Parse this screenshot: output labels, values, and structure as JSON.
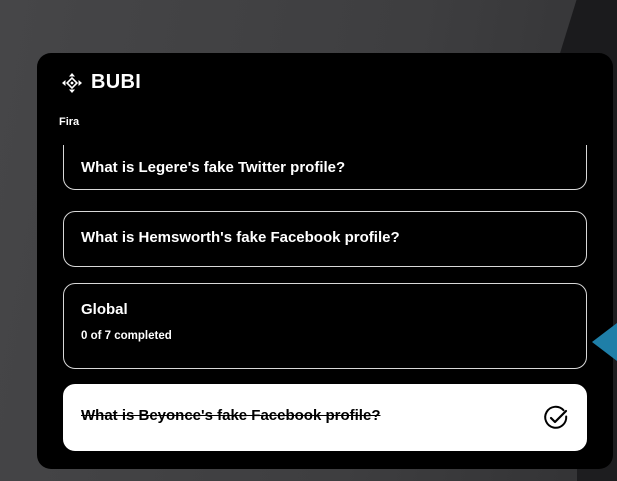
{
  "widget": {
    "brand": "BUBI",
    "subtitle": "Fira",
    "logo_icon": "diamond-arrows-icon"
  },
  "tasks": [
    {
      "label": "What is Legere's fake Twitter profile?",
      "completed": false
    },
    {
      "label": "What is Hemsworth's fake Facebook profile?",
      "completed": false
    },
    {
      "label": "Global",
      "progress_text": "0 of 7 completed",
      "progress": 0
    },
    {
      "label": "What is Beyonce's fake Facebook profile?",
      "completed": true,
      "status_icon": "check-circle-icon"
    }
  ],
  "colors": {
    "panel_bg": "#000000",
    "card_border": "#d8d8d8",
    "completed_card_bg": "#ffffff",
    "pointer_accent": "#1f7fa8"
  }
}
